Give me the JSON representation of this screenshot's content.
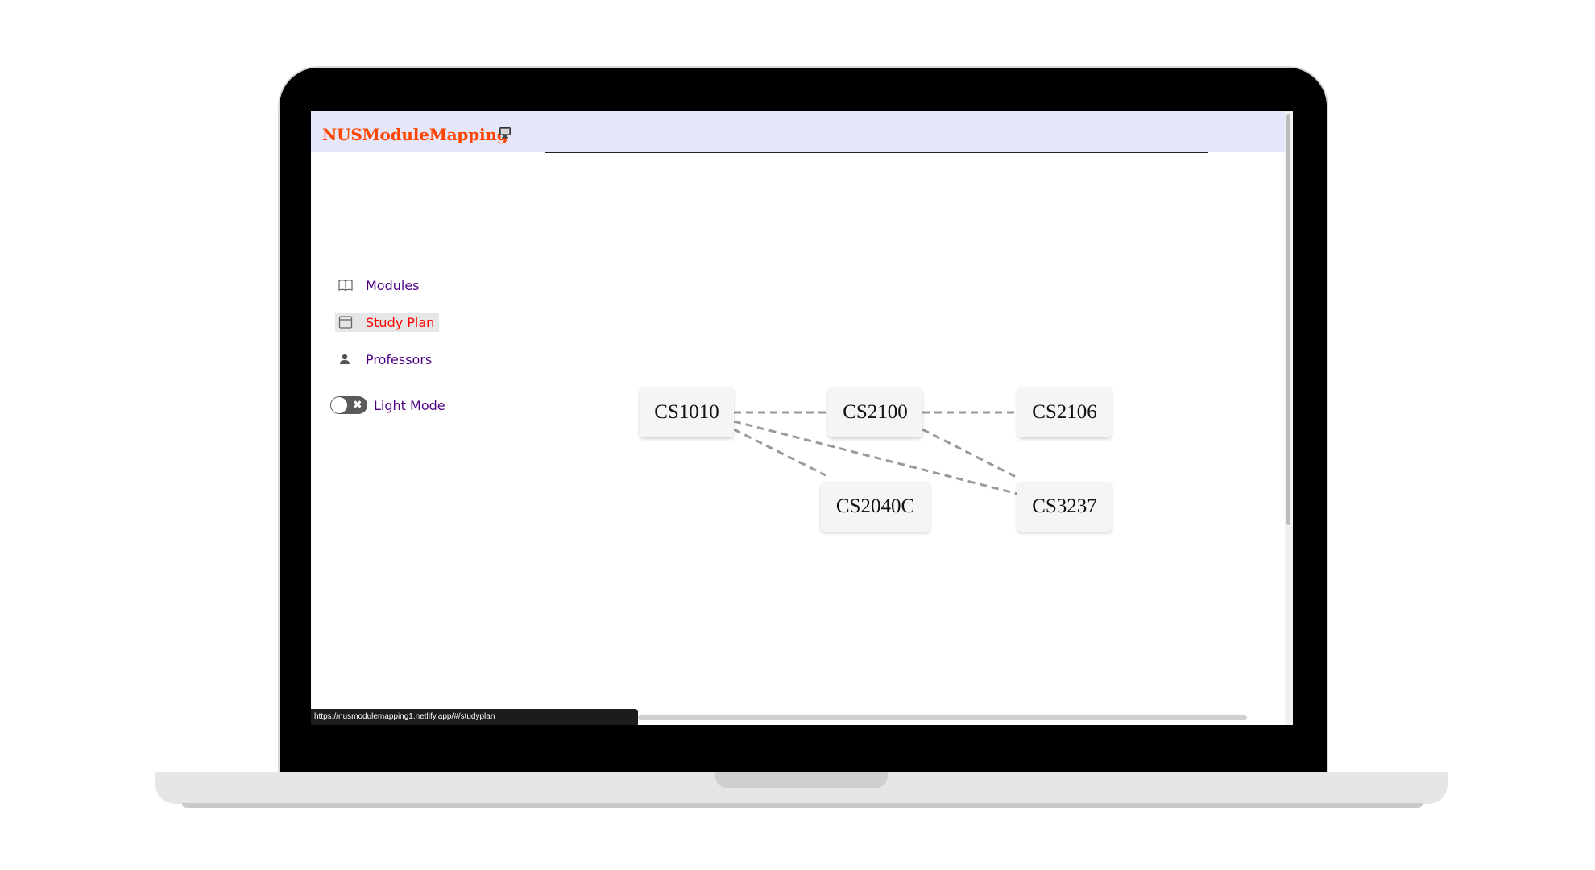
{
  "brand": {
    "name": "NUSModuleMapping",
    "icon": "monitor-icon"
  },
  "sidebar": {
    "items": [
      {
        "label": "Modules",
        "icon": "book-icon",
        "active": false
      },
      {
        "label": "Study Plan",
        "icon": "calendar-icon",
        "active": true
      },
      {
        "label": "Professors",
        "icon": "person-icon",
        "active": false
      }
    ],
    "theme_toggle": {
      "label": "Light Mode",
      "on": false
    }
  },
  "graph": {
    "nodes": [
      "CS1010",
      "CS2100",
      "CS2106",
      "CS2040C",
      "CS3237"
    ],
    "edges": [
      [
        "CS1010",
        "CS2100"
      ],
      [
        "CS2100",
        "CS2106"
      ],
      [
        "CS1010",
        "CS2040C"
      ],
      [
        "CS1010",
        "CS3237"
      ],
      [
        "CS2100",
        "CS3237"
      ]
    ]
  },
  "status_bar": {
    "url": "https://nusmodulemapping1.netlify.app/#/studyplan"
  },
  "colors": {
    "brand": "#ff4500",
    "nav_text": "#4b0082",
    "active_text": "#ff0000",
    "header_bg": "#e6e6fa",
    "edge": "#9a9a9a"
  }
}
